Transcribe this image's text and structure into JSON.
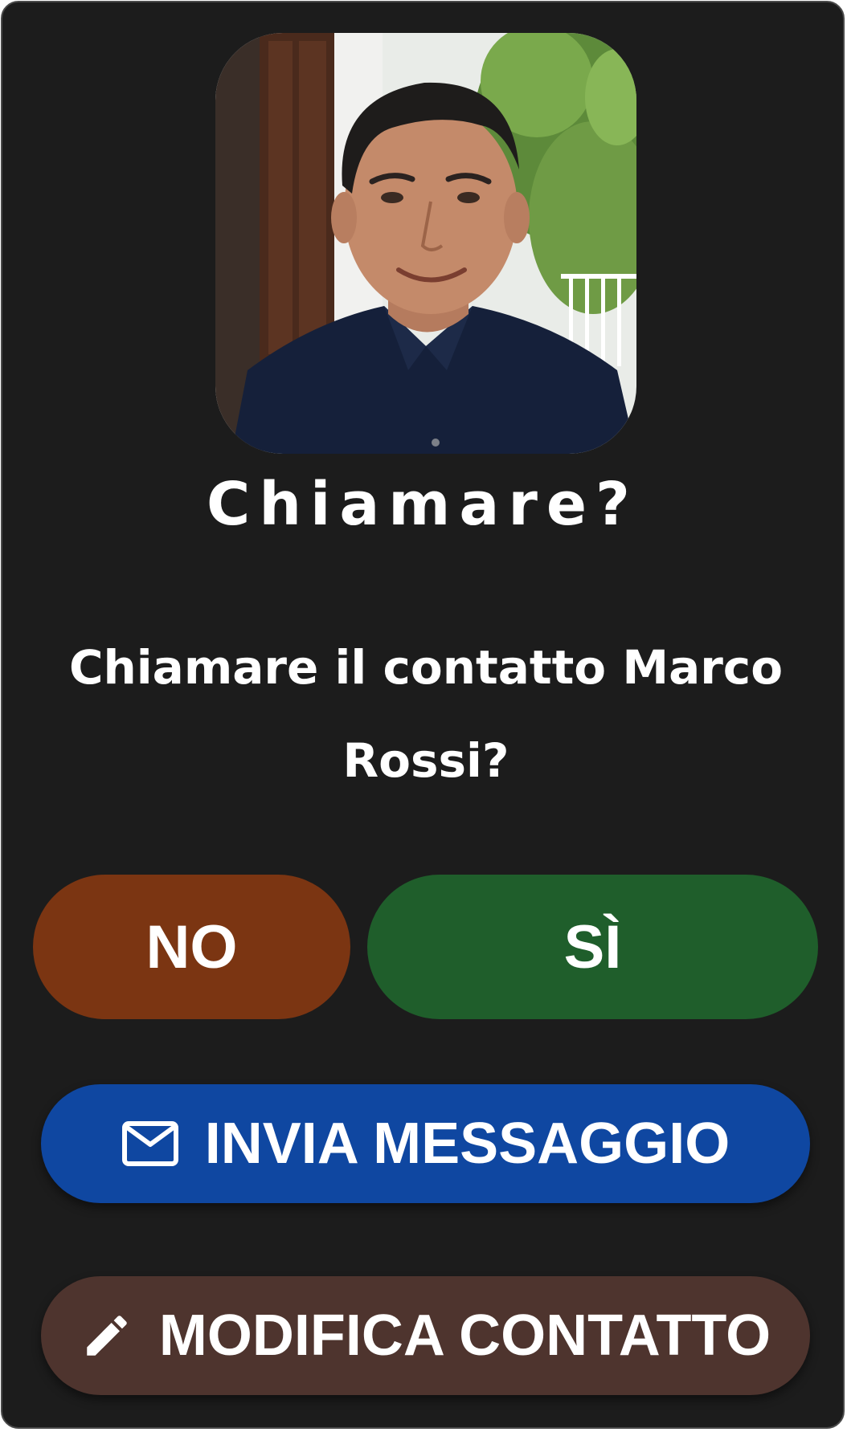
{
  "dialog": {
    "photo_alt": "Marco Rossi",
    "title": "Chiamare?",
    "message": "Chiamare il contatto Marco Rossi?"
  },
  "buttons": {
    "no_label": "NO",
    "yes_label": "SÌ",
    "message_label": "INVIA MESSAGGIO",
    "message_icon": "mail-icon",
    "edit_label": "MODIFICA CONTATTO",
    "edit_icon": "pencil-icon"
  },
  "colors": {
    "background": "#1c1c1c",
    "no": "#7b3512",
    "yes": "#1f5e2b",
    "message": "#0f47a1",
    "edit": "#4e342e",
    "text": "#ffffff"
  }
}
